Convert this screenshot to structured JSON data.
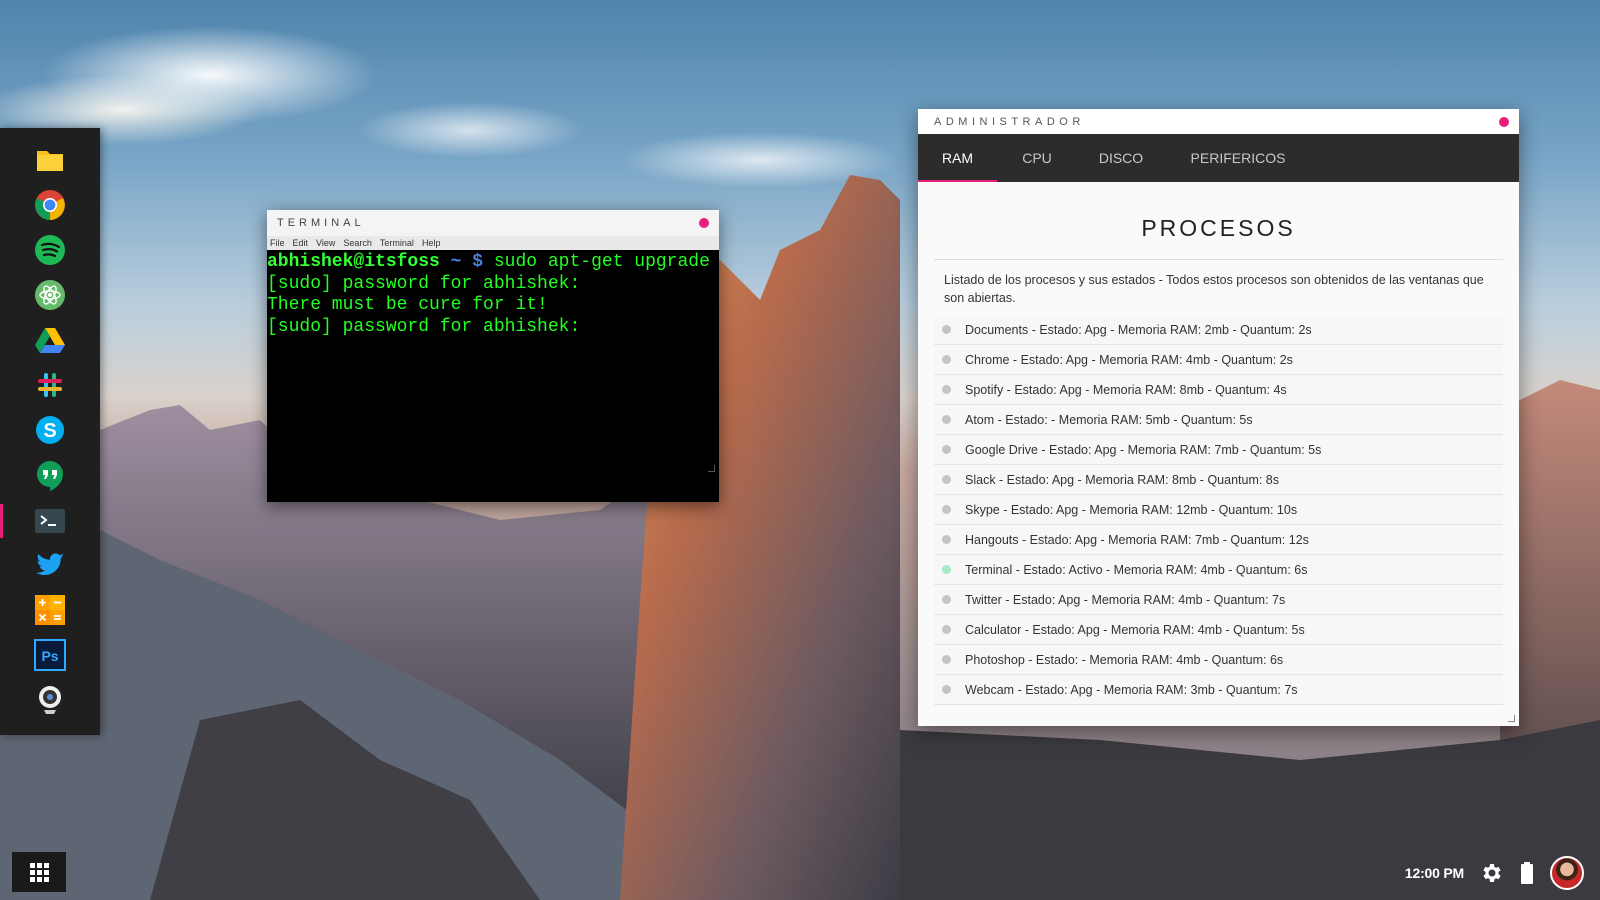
{
  "dock": {
    "items": [
      {
        "name": "files",
        "icon": "folder-icon"
      },
      {
        "name": "chrome",
        "icon": "chrome-icon"
      },
      {
        "name": "spotify",
        "icon": "spotify-icon"
      },
      {
        "name": "atom",
        "icon": "atom-icon"
      },
      {
        "name": "google-drive",
        "icon": "drive-icon"
      },
      {
        "name": "slack",
        "icon": "slack-icon"
      },
      {
        "name": "skype",
        "icon": "skype-icon"
      },
      {
        "name": "hangouts",
        "icon": "hangouts-icon"
      },
      {
        "name": "terminal",
        "icon": "terminal-icon",
        "active": true
      },
      {
        "name": "twitter",
        "icon": "twitter-icon"
      },
      {
        "name": "calculator",
        "icon": "calculator-icon"
      },
      {
        "name": "photoshop",
        "icon": "photoshop-icon"
      },
      {
        "name": "webcam",
        "icon": "webcam-icon"
      }
    ],
    "accent": "#e91e7a"
  },
  "terminal": {
    "title": "TERMINAL",
    "menu": [
      "File",
      "Edit",
      "View",
      "Search",
      "Terminal",
      "Help"
    ],
    "prompt_user": "abhishek@itsfoss",
    "prompt_path": " ~ $",
    "command": " sudo apt-get upgrade",
    "lines": [
      "[sudo] password for abhishek:",
      "There must be cure for it!",
      "[sudo] password for abhishek:"
    ]
  },
  "admin": {
    "title": "ADMINISTRADOR",
    "tabs": [
      "RAM",
      "CPU",
      "DISCO",
      "PERIFERICOS"
    ],
    "active_tab": "RAM",
    "heading": "PROCESOS",
    "description": "Listado de los procesos y sus estados - Todos estos procesos son obtenidos de las ventanas que son abiertas.",
    "processes": [
      {
        "text": "Documents - Estado: Apg - Memoria RAM: 2mb - Quantum: 2s",
        "active": false
      },
      {
        "text": "Chrome - Estado: Apg - Memoria RAM: 4mb - Quantum: 2s",
        "active": false
      },
      {
        "text": "Spotify - Estado: Apg - Memoria RAM: 8mb - Quantum: 4s",
        "active": false
      },
      {
        "text": "Atom - Estado: - Memoria RAM: 5mb - Quantum: 5s",
        "active": false
      },
      {
        "text": "Google Drive - Estado: Apg - Memoria RAM: 7mb - Quantum: 5s",
        "active": false
      },
      {
        "text": "Slack - Estado: Apg - Memoria RAM: 8mb - Quantum: 8s",
        "active": false
      },
      {
        "text": "Skype - Estado: Apg - Memoria RAM: 12mb - Quantum: 10s",
        "active": false
      },
      {
        "text": "Hangouts - Estado: Apg - Memoria RAM: 7mb - Quantum: 12s",
        "active": false
      },
      {
        "text": "Terminal - Estado: Activo - Memoria RAM: 4mb - Quantum: 6s",
        "active": true
      },
      {
        "text": "Twitter - Estado: Apg - Memoria RAM: 4mb - Quantum: 7s",
        "active": false
      },
      {
        "text": "Calculator - Estado: Apg - Memoria RAM: 4mb - Quantum: 5s",
        "active": false
      },
      {
        "text": "Photoshop - Estado: - Memoria RAM: 4mb - Quantum: 6s",
        "active": false
      },
      {
        "text": "Webcam - Estado: Apg - Memoria RAM: 3mb - Quantum: 7s",
        "active": false
      }
    ]
  },
  "taskbar": {
    "apps_button_icon": "grid-icon",
    "clock": "12:00 PM",
    "settings_icon": "gear-icon",
    "battery_icon": "battery-icon",
    "avatar_icon": "user-avatar"
  }
}
